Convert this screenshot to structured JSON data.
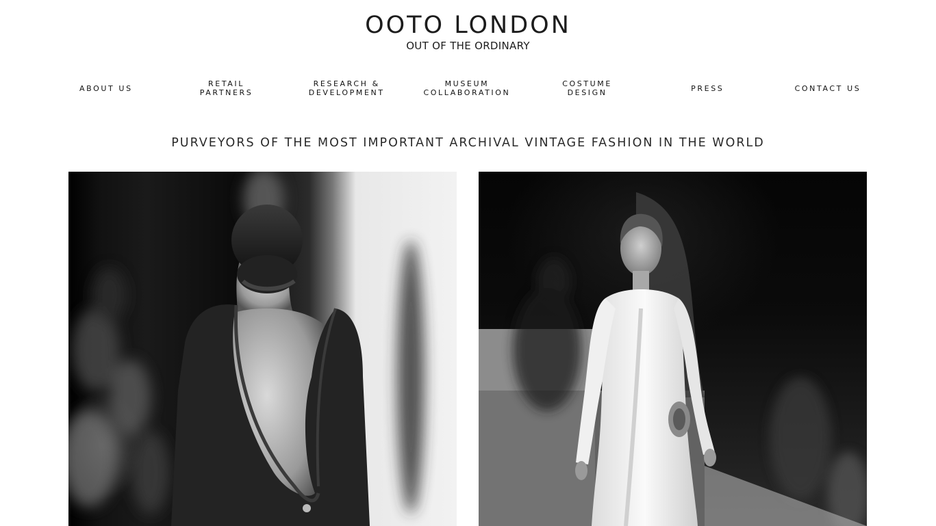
{
  "brand": {
    "title": "OOTO LONDON",
    "tagline": "OUT OF THE ORDINARY"
  },
  "nav": {
    "items": [
      {
        "label": "ABOUT US"
      },
      {
        "label": "RETAIL\nPARTNERS"
      },
      {
        "label": "RESEARCH &\nDEVELOPMENT"
      },
      {
        "label": "MUSEUM\nCOLLABORATION"
      },
      {
        "label": "COSTUME\nDESIGN"
      },
      {
        "label": "PRESS"
      },
      {
        "label": "CONTACT US"
      }
    ]
  },
  "main": {
    "headline": "PURVEYORS OF THE MOST IMPORTANT ARCHIVAL VINTAGE FASHION IN THE WORLD"
  },
  "colors": {
    "background": "#ffffff",
    "text": "#1c1c1c"
  }
}
